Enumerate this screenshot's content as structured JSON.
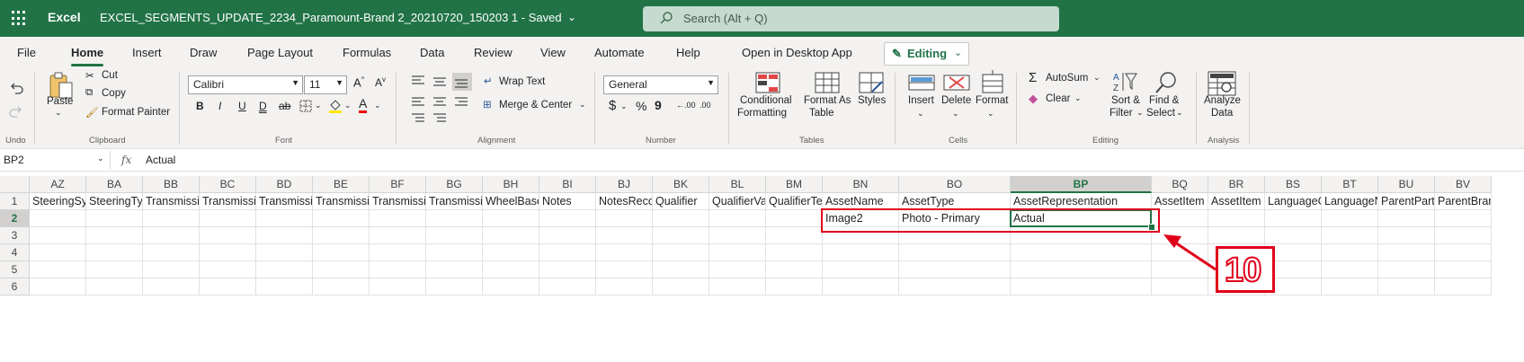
{
  "titlebar": {
    "app_name": "Excel",
    "document_name": "EXCEL_SEGMENTS_UPDATE_2234_Paramount-Brand 2_20210720_150203 1  -  Saved",
    "search_placeholder": "Search (Alt + Q)"
  },
  "menu": {
    "tabs": [
      "File",
      "Home",
      "Insert",
      "Draw",
      "Page Layout",
      "Formulas",
      "Data",
      "Review",
      "View",
      "Automate",
      "Help",
      "Open in Desktop App"
    ],
    "active_tab": "Home",
    "editing_label": "Editing"
  },
  "ribbon": {
    "undo": {
      "group": "Undo"
    },
    "clipboard": {
      "paste": "Paste",
      "cut": "Cut",
      "copy": "Copy",
      "format_painter": "Format Painter",
      "group": "Clipboard"
    },
    "font": {
      "name": "Calibri",
      "size": "11",
      "group": "Font",
      "bold": "B",
      "italic": "I",
      "underline": "U",
      "double_underline": "D",
      "strikethrough": "ab",
      "font_color_glyph": "A"
    },
    "alignment": {
      "wrap_text": "Wrap Text",
      "merge_center": "Merge & Center",
      "group": "Alignment"
    },
    "number": {
      "format": "General",
      "currency": "$",
      "percent": "%",
      "comma": "9",
      "increase_decimal": "←.00",
      "decrease_decimal": ".00",
      "group": "Number"
    },
    "tables": {
      "conditional": "Conditional",
      "formatting": "Formatting",
      "format_as": "Format As",
      "table": "Table",
      "styles": "Styles",
      "group": "Tables"
    },
    "cells": {
      "insert": "Insert",
      "delete": "Delete",
      "format": "Format",
      "group": "Cells"
    },
    "editing": {
      "autosum": "AutoSum",
      "clear": "Clear",
      "sort": "Sort &",
      "filter": "Filter",
      "find": "Find &",
      "select": "Select",
      "group": "Editing"
    },
    "analysis": {
      "analyze": "Analyze",
      "data": "Data",
      "group": "Analysis"
    }
  },
  "formula_bar": {
    "name_box": "BP2",
    "fx": "fx",
    "value": "Actual"
  },
  "grid": {
    "columns": [
      "AZ",
      "BA",
      "BB",
      "BC",
      "BD",
      "BE",
      "BF",
      "BG",
      "BH",
      "BI",
      "BJ",
      "BK",
      "BL",
      "BM",
      "BN",
      "BO",
      "BP",
      "BQ",
      "BR",
      "BS",
      "BT",
      "BU",
      "BV"
    ],
    "selected_column": "BP",
    "rows": [
      "1",
      "2",
      "3",
      "4",
      "5",
      "6"
    ],
    "selected_row": "2",
    "row1": [
      "SteeringSy",
      "SteeringTy",
      "Transmissi",
      "Transmissi",
      "Transmissi",
      "Transmissi",
      "Transmissi",
      "Transmissi",
      "WheelBase",
      "Notes",
      "NotesReco",
      "Qualifier",
      "QualifierVa",
      "QualifierTe",
      "AssetName",
      "AssetType",
      "AssetRepresentation",
      "AssetItem",
      "AssetItem",
      "LanguageC",
      "LanguageN",
      "ParentPart",
      "ParentBrand"
    ],
    "row2": [
      "",
      "",
      "",
      "",
      "",
      "",
      "",
      "",
      "",
      "",
      "",
      "",
      "",
      "",
      "Image2",
      "Photo - Primary",
      "Actual",
      "",
      "",
      "",
      "",
      "",
      ""
    ]
  },
  "annotation": {
    "step_number": "10",
    "color": "#e0001b"
  }
}
